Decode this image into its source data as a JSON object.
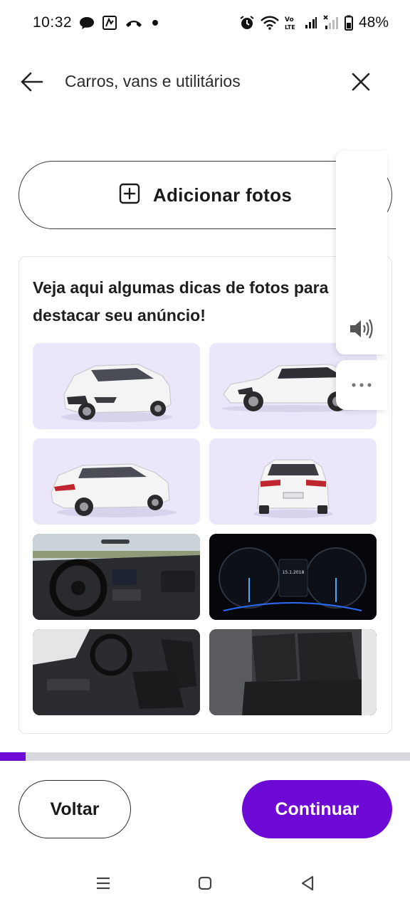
{
  "status_bar": {
    "time": "10:32",
    "battery": "48%",
    "icons": [
      "chat-bubble-icon",
      "app-notification-icon",
      "missed-call-icon",
      "dot-icon",
      "alarm-icon",
      "wifi-icon",
      "volte-icon",
      "signal-icon",
      "signal-weak-icon",
      "battery-icon"
    ]
  },
  "header": {
    "title": "Carros, vans e utilitários",
    "back_icon": "arrow-left-icon",
    "close_icon": "close-icon"
  },
  "add_photos": {
    "label": "Adicionar fotos",
    "icon": "plus-square-icon"
  },
  "tips": {
    "text": "Veja aqui algumas dicas de fotos para destacar seu anúncio!",
    "photos": [
      {
        "name": "front-three-quarter-photo"
      },
      {
        "name": "side-profile-photo"
      },
      {
        "name": "rear-three-quarter-photo"
      },
      {
        "name": "rear-photo"
      },
      {
        "name": "dashboard-photo"
      },
      {
        "name": "instrument-cluster-photo"
      },
      {
        "name": "front-seats-photo"
      },
      {
        "name": "rear-seats-photo"
      }
    ],
    "cluster_date": "15.1.2018"
  },
  "floating": {
    "speaker_icon": "speaker-icon",
    "more_icon": "more-horizontal-icon"
  },
  "progress": {
    "value": 0.062
  },
  "footer": {
    "back_label": "Voltar",
    "continue_label": "Continuar"
  },
  "nav_bar": {
    "icons": [
      "recents-icon",
      "home-icon",
      "back-triangle-icon"
    ]
  },
  "colors": {
    "primary": "#6e0ad6",
    "tile_bg": "#ece6fb",
    "progress_track": "#d6d8dc"
  }
}
